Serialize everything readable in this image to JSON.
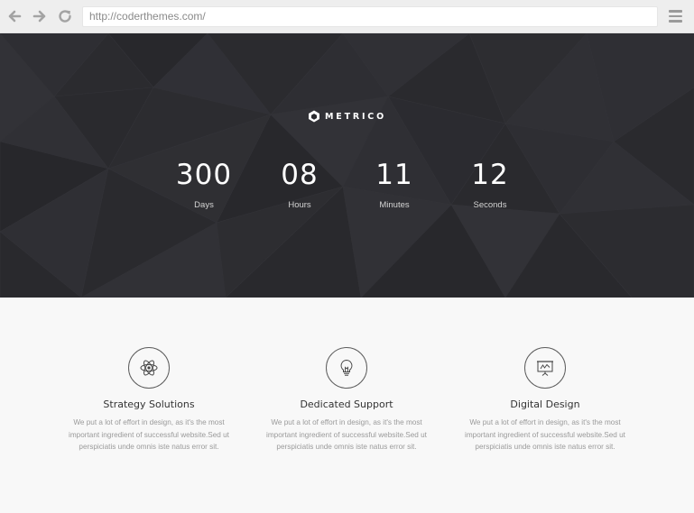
{
  "browser": {
    "url": "http://coderthemes.com/",
    "icons": [
      "arrow-left-icon",
      "arrow-right-icon",
      "reload-icon",
      "hamburger-menu-icon"
    ]
  },
  "hero": {
    "brand": "METRICO",
    "countdown": [
      {
        "value": "300",
        "label": "Days"
      },
      {
        "value": "08",
        "label": "Hours"
      },
      {
        "value": "11",
        "label": "Minutes"
      },
      {
        "value": "12",
        "label": "Seconds"
      }
    ]
  },
  "features": [
    {
      "icon": "atom-icon",
      "title": "Strategy Solutions",
      "text": "We put a lot of effort in design, as it's the most important ingredient of successful website.Sed ut perspiciatis unde omnis iste natus error sit."
    },
    {
      "icon": "lightbulb-icon",
      "title": "Dedicated Support",
      "text": "We put a lot of effort in design, as it's the most important ingredient of successful website.Sed ut perspiciatis unde omnis iste natus error sit."
    },
    {
      "icon": "presentation-board-icon",
      "title": "Digital Design",
      "text": "We put a lot of effort in design, as it's the most important ingredient of successful website.Sed ut perspiciatis unde omnis iste natus error sit."
    }
  ],
  "colors": {
    "hero_bg": "#2b2b2f",
    "page_bg": "#f8f8f8",
    "title_text": "#333333",
    "body_text": "#9a9a9a"
  }
}
